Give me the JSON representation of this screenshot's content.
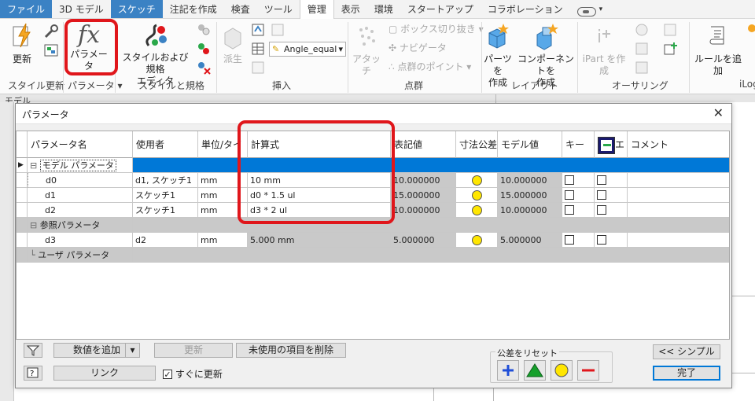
{
  "menubar": {
    "tabs": [
      "ファイル",
      "3D モデル",
      "スケッチ",
      "注記を作成",
      "検査",
      "ツール",
      "管理",
      "表示",
      "環境",
      "スタートアップ",
      "コラボレーション"
    ],
    "active_tab": "管理"
  },
  "ribbon": {
    "update_label": "更新",
    "param_label": "パラメータ",
    "style_editor_label_1": "スタイルおよび規格",
    "style_editor_label_2": "エディタ",
    "derive_label": "派生",
    "angle_combo": "Angle_equal",
    "attach_label": "アタッチ",
    "box_crop_label": "ボックス切り抜き",
    "navigate_label": "ナビゲータ",
    "point_cloud_label": "点群のポイント",
    "parts_label_1": "パーツを",
    "parts_label_2": "作成",
    "comp_label_1": "コンポーネントを",
    "comp_label_2": "作成",
    "ipart_label": "iPart を作成",
    "rule_label": "ルールを追加",
    "groups": {
      "style_update": "スタイル更新",
      "param": "パラメータ ▾",
      "style_std": "スタイルと規格",
      "insert": "挿入",
      "point_cloud": "点群",
      "layout": "レイアウト",
      "authoring": "オーサリング",
      "ilogic": "iLog"
    },
    "model_tab": "モデル"
  },
  "dialog": {
    "title": "パラメータ",
    "close": "✕",
    "headers": {
      "name": "パラメータ名",
      "used_by": "使用者",
      "unit": "単位/タイ",
      "equation": "計算式",
      "nominal": "表記値",
      "tol": "寸法公差",
      "model_value": "モデル値",
      "key": "キー",
      "export": "エ",
      "comment": "コメント"
    },
    "groups": {
      "model": "モデル パラメータ",
      "reference": "参照パラメータ",
      "user": "ユーザ パラメータ"
    },
    "rows": [
      {
        "name": "d0",
        "used_by": "d1, スケッチ1",
        "unit": "mm",
        "equation": "10 mm",
        "nominal": "10.000000",
        "model_value": "10.000000"
      },
      {
        "name": "d1",
        "used_by": "スケッチ1",
        "unit": "mm",
        "equation": "d0 * 1.5 ul",
        "nominal": "15.000000",
        "model_value": "15.000000"
      },
      {
        "name": "d2",
        "used_by": "スケッチ1",
        "unit": "mm",
        "equation": "d3 * 2 ul",
        "nominal": "10.000000",
        "model_value": "10.000000"
      }
    ],
    "ref_rows": [
      {
        "name": "d3",
        "used_by": "d2",
        "unit": "mm",
        "equation": "5.000 mm",
        "nominal": "5.000000",
        "model_value": "5.000000"
      }
    ],
    "buttons": {
      "add_value": "数値を追加",
      "update": "更新",
      "purge": "未使用の項目を削除",
      "link": "リンク",
      "immediate_update": "すぐに更新",
      "reset_tol": "公差をリセット",
      "simple": "<< シンプル",
      "done": "完了"
    }
  },
  "colors": {
    "highlight_red": "#e0161b",
    "selection_blue": "#0078d7",
    "sketch_tab_blue": "#3b82c4"
  }
}
